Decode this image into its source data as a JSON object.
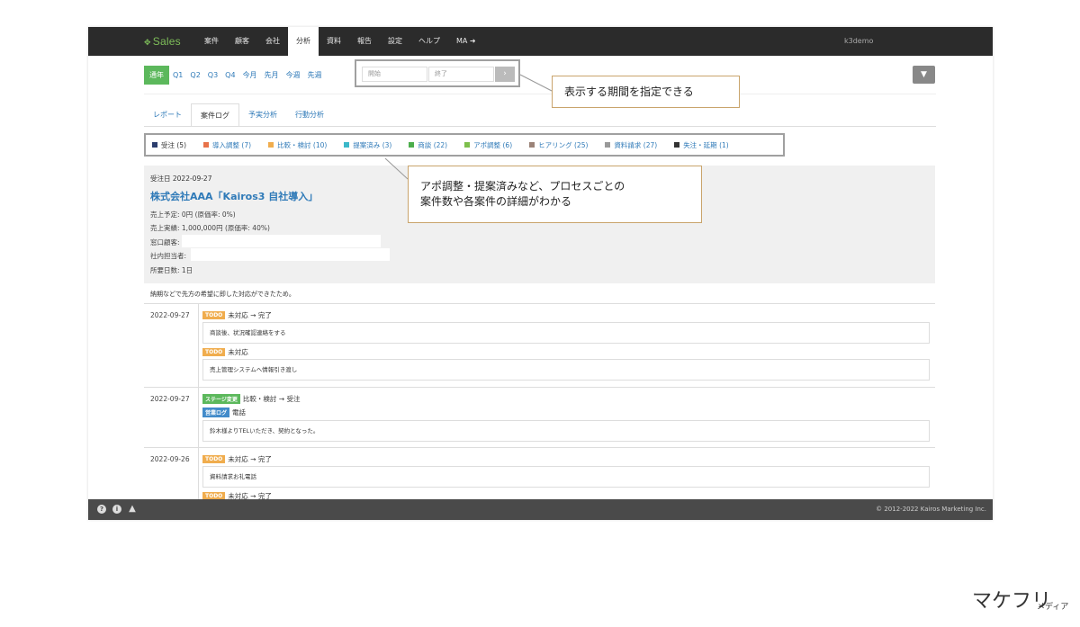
{
  "app": {
    "logo": "Sales",
    "logo_mark": "✥",
    "user": "k3demo"
  },
  "nav": [
    "案件",
    "顧客",
    "会社",
    "分析",
    "資料",
    "報告",
    "設定",
    "ヘルプ",
    "MA ➜"
  ],
  "nav_active_index": 3,
  "periods": [
    "通年",
    "Q1",
    "Q2",
    "Q3",
    "Q4",
    "今月",
    "先月",
    "今週",
    "先週"
  ],
  "date_range": {
    "start_placeholder": "開始",
    "end_placeholder": "終了",
    "go_label": "›"
  },
  "filter_label": "▼",
  "subtabs": [
    "レポート",
    "案件ログ",
    "予実分析",
    "行動分析"
  ],
  "subtab_active_index": 1,
  "stages": [
    {
      "label": "受注 (5)",
      "color": "#2c3e6e"
    },
    {
      "label": "導入調整 (7)",
      "color": "#e8734a"
    },
    {
      "label": "比較・検討 (10)",
      "color": "#f0ad4e"
    },
    {
      "label": "提案済み (3)",
      "color": "#3bb8c9"
    },
    {
      "label": "商談 (22)",
      "color": "#4cae4c"
    },
    {
      "label": "アポ調整 (6)",
      "color": "#7dbf4c"
    },
    {
      "label": "ヒアリング (25)",
      "color": "#9b8378"
    },
    {
      "label": "資料請求 (27)",
      "color": "#999999"
    },
    {
      "label": "失注・延期 (1)",
      "color": "#333333"
    }
  ],
  "deal": {
    "order_date": "受注日 2022-09-27",
    "company": "株式会社AAA「Kairos3 自社導入」",
    "planned": "売上予定: 0円 (原価率: 0%)",
    "actual": "売上実績: 1,000,000円 (原価率: 40%)",
    "contact_label": "窓口顧客:",
    "owner_label": "社内担当者:",
    "days": "所要日数: 1日",
    "comment": "納期などで先方の希望に即した対応ができたため。"
  },
  "entries": [
    {
      "date": "2022-09-27",
      "items": [
        {
          "badge": "TODO",
          "text": "未対応 → 完了",
          "note": "商談後、状況確認連絡をする"
        },
        {
          "badge": "TODO",
          "text": "未対応",
          "note": "売上管理システムへ情報引き渡し"
        }
      ]
    },
    {
      "date": "2022-09-27",
      "stage_badge": "ステージ変更",
      "stage_text": "比較・検討 → 受注",
      "log_badge": "営業ログ",
      "log_text": "電話",
      "note": "鈴木様よりTELいただき、契約となった。"
    },
    {
      "date": "2022-09-26",
      "items": [
        {
          "badge": "TODO",
          "text": "未対応 → 完了",
          "note": "資料請求お礼電話"
        },
        {
          "badge": "TODO",
          "text": "未対応 → 完了"
        }
      ]
    }
  ],
  "footer": {
    "copyright": "© 2012-2022 Kairos Marketing Inc.",
    "icons": [
      "?",
      "i",
      "▲"
    ]
  },
  "callouts": {
    "period": "表示する期間を指定できる",
    "stages_line1": "アポ調整・提案済みなど、プロセスごとの",
    "stages_line2": "案件数や各案件の詳細がわかる"
  },
  "brand": {
    "name": "マケフリ",
    "sub": "メディア"
  }
}
